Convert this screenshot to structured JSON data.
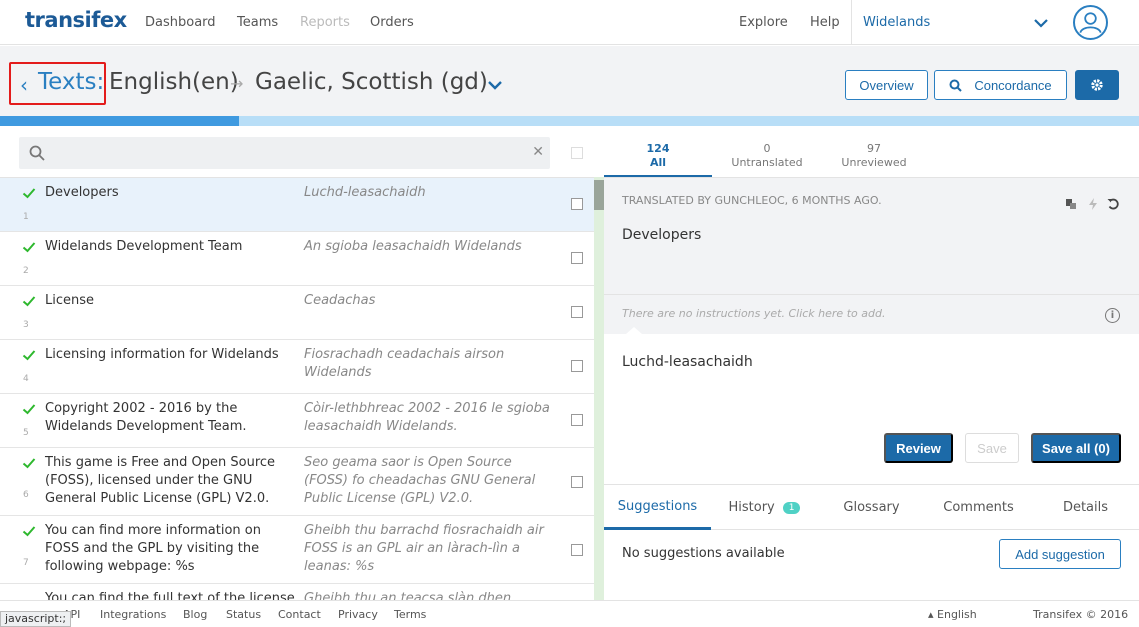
{
  "nav": {
    "logo": "transifex",
    "links": [
      "Dashboard",
      "Teams",
      "Reports",
      "Orders"
    ],
    "explore": "Explore",
    "help": "Help",
    "project": "Widelands"
  },
  "header": {
    "back_label": "Texts:",
    "source_language": "English(en)",
    "arrow": "→",
    "target_language": "Gaelic, Scottish (gd)",
    "overview_label": "Overview",
    "concordance_label": "Concordance"
  },
  "progress": {
    "translated_fraction": 0.21
  },
  "list_toolbar": {
    "clear_glyph": "✕"
  },
  "stats": [
    {
      "count": "124",
      "label": "All"
    },
    {
      "count": "0",
      "label": "Untranslated"
    },
    {
      "count": "97",
      "label": "Unreviewed"
    }
  ],
  "strings": [
    {
      "num": "1",
      "source": "Developers",
      "translation": "Luchd-leasachaidh"
    },
    {
      "num": "2",
      "source": "Widelands Development Team",
      "translation": "An sgioba leasachaidh Widelands"
    },
    {
      "num": "3",
      "source": "License",
      "translation": "Ceadachas"
    },
    {
      "num": "4",
      "source": "Licensing information for Widelands",
      "translation": "Fiosrachadh ceadachais airson Widelands"
    },
    {
      "num": "5",
      "source": "Copyright 2002 - 2016 by the Widelands Development Team.",
      "translation": "Còir-lethbhreac 2002 - 2016 le sgioba leasachaidh Widelands."
    },
    {
      "num": "6",
      "source": "This game is Free and Open Source (FOSS), licensed under the GNU General Public License (GPL) V2.0.",
      "translation": "Seo geama saor is Open Source (FOSS) fo cheadachas GNU General Public License (GPL) V2.0."
    },
    {
      "num": "7",
      "source": "You can find more information on FOSS and the GPL by visiting the following webpage: %s",
      "translation": "Gheibh thu barrachd fiosrachaidh air FOSS is an GPL air an làrach-lìn a leanas: %s"
    },
    {
      "num": "",
      "source": "You can find the full text of the license",
      "translation": "Gheibh thu an teacsa slàn dhen"
    }
  ],
  "editor": {
    "translated_by": "TRANSLATED BY GUNCHLEOC, 6 MONTHS AGO.",
    "source_text": "Developers",
    "instructions": "There are no instructions yet. Click here to add.",
    "info_glyph": "i",
    "translation_text": "Luchd-leasachaidh",
    "review_label": "Review",
    "save_label": "Save",
    "save_all_label": "Save all (0)",
    "tabs": [
      {
        "label": "Suggestions"
      },
      {
        "label": "History",
        "badge": "1"
      },
      {
        "label": "Glossary"
      },
      {
        "label": "Comments"
      },
      {
        "label": "Details"
      }
    ],
    "no_suggestions": "No suggestions available",
    "add_suggestion_label": "Add suggestion"
  },
  "footer": {
    "links": [
      "API",
      "Integrations",
      "Blog",
      "Status",
      "Contact",
      "Privacy",
      "Terms"
    ],
    "language": "▴ English",
    "copyright": "Transifex © 2016",
    "status_tip": "javascript:;"
  },
  "colors": {
    "brand": "#1c6aa8",
    "accent": "#2a7fc1",
    "check": "#2eb82e",
    "highlight": "#e31b1b"
  }
}
